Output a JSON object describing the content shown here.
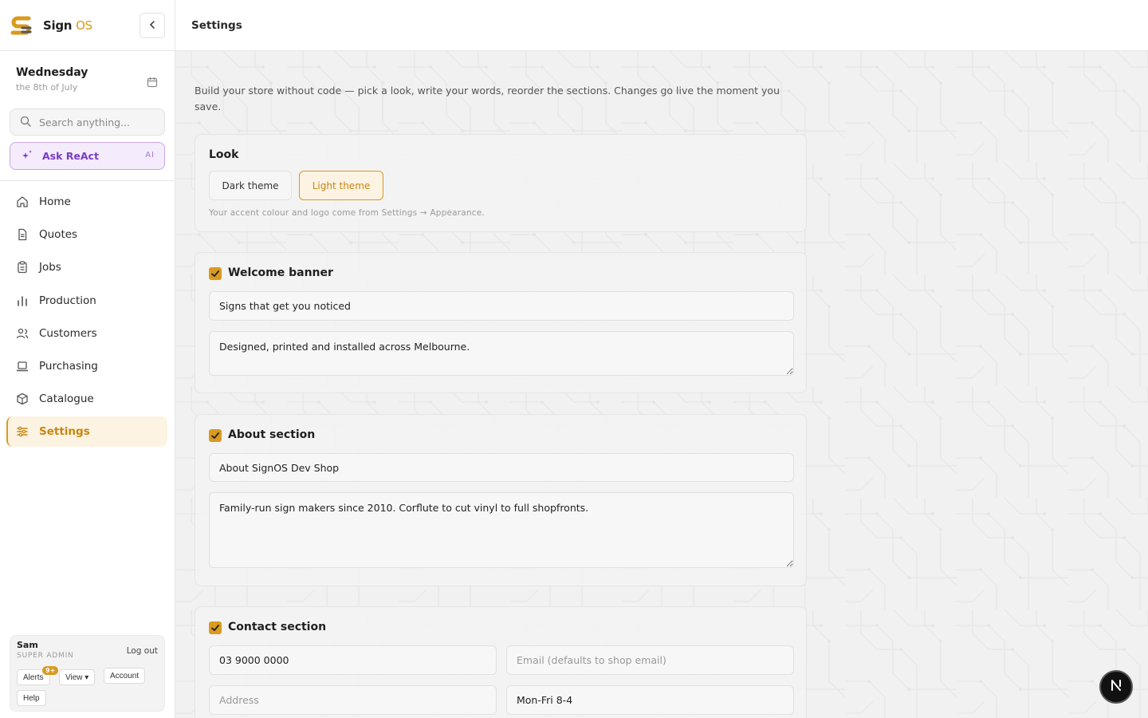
{
  "brand": {
    "name": "Sign",
    "name_accent": "OS"
  },
  "header": {
    "title": "Settings"
  },
  "date": {
    "day": "Wednesday",
    "sub": "the 8th of July"
  },
  "search": {
    "placeholder": "Search anything..."
  },
  "ask": {
    "label": "Ask ReAct",
    "tag": "AI"
  },
  "nav": {
    "items": [
      {
        "label": "Home",
        "icon": "home-icon"
      },
      {
        "label": "Quotes",
        "icon": "document-icon"
      },
      {
        "label": "Jobs",
        "icon": "clipboard-icon"
      },
      {
        "label": "Production",
        "icon": "bar-chart-icon"
      },
      {
        "label": "Customers",
        "icon": "users-icon"
      },
      {
        "label": "Purchasing",
        "icon": "laptop-icon"
      },
      {
        "label": "Catalogue",
        "icon": "box-icon"
      },
      {
        "label": "Settings",
        "icon": "sliders-icon",
        "active": true
      }
    ]
  },
  "user": {
    "name": "Sam",
    "role": "SUPER ADMIN",
    "logout": "Log out",
    "alerts": "Alerts",
    "alerts_badge": "9+",
    "view": "View ▾",
    "account": "Account",
    "help": "Help"
  },
  "main": {
    "intro": "Build your store without code — pick a look, write your words, reorder the sections. Changes go live the moment you save.",
    "look": {
      "title": "Look",
      "dark": "Dark theme",
      "light": "Light theme",
      "selected": "Light theme",
      "hint": "Your accent colour and logo come from Settings → Appearance."
    },
    "welcome": {
      "title": "Welcome banner",
      "enabled": true,
      "heading": "Signs that get you noticed",
      "body": "Designed, printed and installed across Melbourne."
    },
    "about": {
      "title": "About section",
      "enabled": true,
      "heading": "About SignOS Dev Shop",
      "body": "Family-run sign makers since 2010. Corflute to cut vinyl to full shopfronts."
    },
    "contact": {
      "title": "Contact section",
      "enabled": true,
      "phone": "03 9000 0000",
      "email_placeholder": "Email (defaults to shop email)",
      "address_placeholder": "Address",
      "hours": "Mon-Fri 8-4"
    }
  },
  "colors": {
    "accent": "#d99a1e",
    "ai": "#7a3bc4",
    "active_bg": "#fdf3e2"
  }
}
